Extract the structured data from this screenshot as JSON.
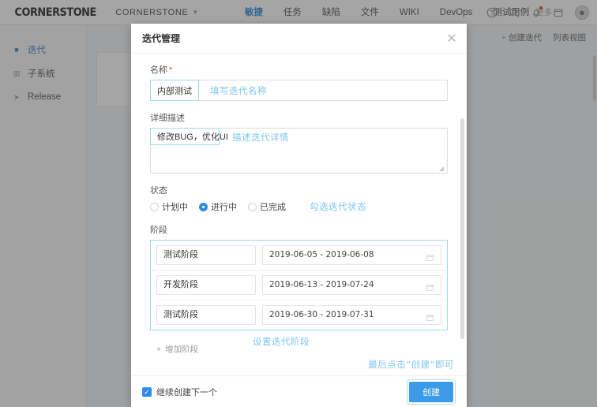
{
  "topbar": {
    "logo": "CORNERSTONE",
    "project": "CORNERSTONE",
    "project_caret": "chevron-down",
    "nav": [
      {
        "label": "敏捷",
        "active": true
      },
      {
        "label": "任务",
        "active": false
      },
      {
        "label": "缺陷",
        "active": false
      },
      {
        "label": "文件",
        "active": false
      },
      {
        "label": "WIKI",
        "active": false
      },
      {
        "label": "DevOps",
        "active": false
      },
      {
        "label": "测试用例",
        "active": false
      }
    ],
    "more": "更多",
    "icons": [
      "help-icon",
      "search-icon",
      "notification-bell-icon",
      "calendar-icon",
      "avatar"
    ]
  },
  "sidebar": {
    "items": [
      {
        "label": "迭代",
        "icon": "square-icon",
        "active": true
      },
      {
        "label": "子系统",
        "icon": "grid-icon",
        "active": false
      },
      {
        "label": "Release",
        "icon": "paper-plane-icon",
        "active": false
      }
    ]
  },
  "content": {
    "create_iteration": "创建迭代",
    "plus": "+",
    "list_view": "列表视图"
  },
  "modal": {
    "title": "迭代管理",
    "close": "×",
    "name": {
      "label": "名称",
      "required_mark": "*",
      "value": "内部测试",
      "placeholder": "",
      "note": "填写迭代名称"
    },
    "description": {
      "label": "详细描述",
      "value": "修改BUG，优化UI",
      "note": "描述迭代详情"
    },
    "status": {
      "label": "状态",
      "options": [
        {
          "label": "计划中",
          "selected": false
        },
        {
          "label": "进行中",
          "selected": true
        },
        {
          "label": "已完成",
          "selected": false
        }
      ],
      "note": "勾选迭代状态"
    },
    "phase": {
      "label": "阶段",
      "rows": [
        {
          "name": "测试阶段",
          "date": "2019-06-05 - 2019-06-08"
        },
        {
          "name": "开发阶段",
          "date": "2019-06-13 - 2019-07-24"
        },
        {
          "name": "测试阶段",
          "date": "2019-06-30 - 2019-07-31"
        }
      ],
      "add_label": "增加阶段",
      "add_plus": "+",
      "note": "设置迭代阶段"
    },
    "final_note": "最后点击“创建”即可",
    "footer": {
      "checkbox_label": "继续创建下一个",
      "checkbox_checked": true,
      "checkbox_glyph": "✓",
      "create_label": "创建"
    }
  },
  "colors": {
    "accent": "#3c9ae8",
    "note": "#7ec6ef",
    "highlight_border": "#9fd8ee",
    "required": "#f04134",
    "badge": "#f04134"
  }
}
